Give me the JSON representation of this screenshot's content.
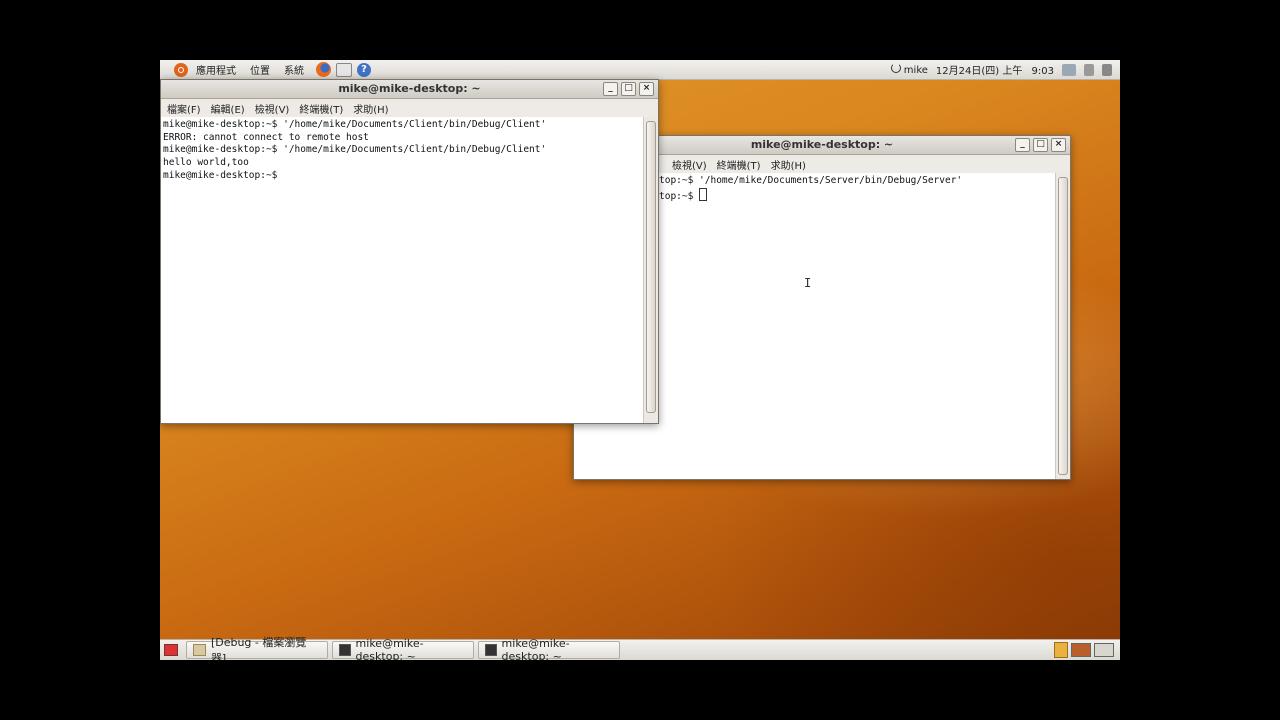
{
  "top_panel": {
    "menus": [
      "應用程式",
      "位置",
      "系統"
    ],
    "user": "mike",
    "date": "12月24日(四) 上午",
    "time": "9:03"
  },
  "windows": [
    {
      "id": "client",
      "title": "mike@mike-desktop: ~",
      "menu": [
        "檔案(F)",
        "編輯(E)",
        "檢視(V)",
        "終端機(T)",
        "求助(H)"
      ],
      "lines": [
        "mike@mike-desktop:~$ '/home/mike/Documents/Client/bin/Debug/Client'",
        "ERROR: cannot connect to remote host",
        "mike@mike-desktop:~$ '/home/mike/Documents/Client/bin/Debug/Client'",
        "hello world,too",
        "mike@mike-desktop:~$"
      ]
    },
    {
      "id": "server",
      "title": "mike@mike-desktop: ~",
      "menu": [
        "檢視(V)",
        "終端機(T)",
        "求助(H)"
      ],
      "lines": [
        "top:~$ '/home/mike/Documents/Server/bin/Debug/Server'",
        "",
        "top:~$ "
      ]
    }
  ],
  "window_controls": {
    "minimize": "_",
    "maximize": "□",
    "close": "×"
  },
  "taskbar": {
    "items": [
      {
        "label": "[Debug - 檔案瀏覽器]",
        "icon": "folder-icon"
      },
      {
        "label": "mike@mike-desktop: ~",
        "icon": "terminal-icon"
      },
      {
        "label": "mike@mike-desktop: ~",
        "icon": "terminal-icon"
      }
    ]
  },
  "colors": {
    "desktop_orange": "#d9861f",
    "panel": "#e8e6e2"
  }
}
